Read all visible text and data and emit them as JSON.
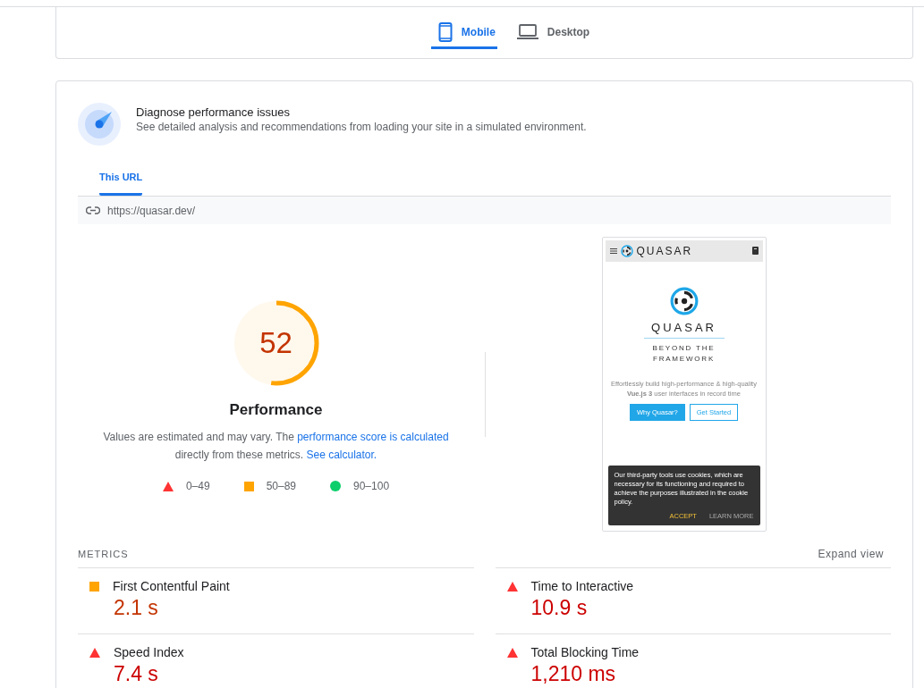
{
  "device_tabs": [
    {
      "label": "Mobile",
      "kind": "mobile",
      "selected": true
    },
    {
      "label": "Desktop",
      "kind": "desktop",
      "selected": false
    }
  ],
  "diagnose": {
    "title": "Diagnose performance issues",
    "subtitle": "See detailed analysis and recommendations from loading your site in a simulated environment."
  },
  "url_tabs": [
    {
      "label": "This URL",
      "selected": true
    }
  ],
  "url": "https://quasar.dev/",
  "score": {
    "value": "52",
    "level": 0.52,
    "title": "Performance",
    "note_before": "Values are estimated and may vary. The ",
    "note_link": "performance score is calculated",
    "note_middle": " directly from these metrics. ",
    "note_link2": "See calculator."
  },
  "legend": [
    {
      "kind": "fail",
      "label": "0–49"
    },
    {
      "kind": "average",
      "label": "50–89"
    },
    {
      "kind": "pass",
      "label": "90–100"
    }
  ],
  "preview": {
    "brand": "QUASAR",
    "hero_title": "QUASAR",
    "tagline": "BEYOND THE FRAMEWORK",
    "description": "Effortlessly build high-performance & high-quality **Vue.js 3** user interfaces in record time",
    "buttons": [
      {
        "label": "Why Quasar?",
        "kind": "primary"
      },
      {
        "label": "Get Started",
        "kind": "outline"
      }
    ],
    "cookie_text": "Our third-party tools use cookies, which are necessary for its functioning and required to achieve the purposes illustrated in the cookie policy.",
    "cookie_actions": [
      {
        "label": "ACCEPT",
        "kind": "accent"
      },
      {
        "label": "LEARN MORE",
        "kind": "plain"
      }
    ]
  },
  "metrics": {
    "title": "METRICS",
    "expand": "Expand view",
    "items": [
      {
        "name": "First Contentful Paint",
        "value": "2.1 s",
        "kind": "average"
      },
      {
        "name": "Time to Interactive",
        "value": "10.9 s",
        "kind": "fail"
      },
      {
        "name": "Speed Index",
        "value": "7.4 s",
        "kind": "fail"
      },
      {
        "name": "Total Blocking Time",
        "value": "1,210 ms",
        "kind": "fail"
      }
    ]
  }
}
